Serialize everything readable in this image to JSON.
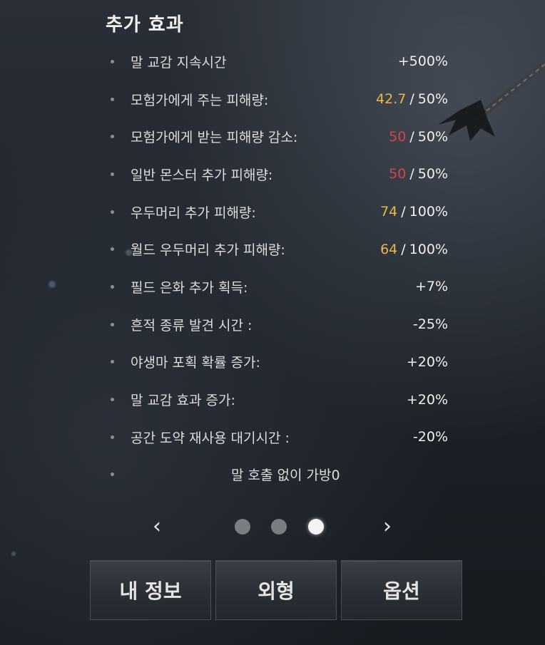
{
  "section": {
    "title": "추가 효과"
  },
  "effects": [
    {
      "label": "말 교감 지속시간",
      "value": "+500%"
    },
    {
      "label": "모험가에게 주는 피해량:",
      "current": "42.7",
      "current_color": "#e8b84a",
      "max": "50%"
    },
    {
      "label": "모험가에게 받는 피해량 감소:",
      "current": "50",
      "current_color": "#d5454a",
      "max": "50%"
    },
    {
      "label": "일반 몬스터 추가 피해량:",
      "current": "50",
      "current_color": "#d5454a",
      "max": "50%"
    },
    {
      "label": "우두머리 추가 피해량:",
      "current": "74",
      "current_color": "#e8b84a",
      "max": "100%"
    },
    {
      "label": "월드 우두머리 추가 피해량:",
      "current": "64",
      "current_color": "#e8b84a",
      "max": "100%"
    },
    {
      "label": "필드 은화 추가 획득:",
      "value": "+7%"
    },
    {
      "label": "흔적 종류 발견 시간 :",
      "value": "-25%"
    },
    {
      "label": "야생마 포획 확률 증가:",
      "value": "+20%"
    },
    {
      "label": "말 교감 효과 증가:",
      "value": "+20%"
    },
    {
      "label": "공간 도약 재사용 대기시간 :",
      "value": "-20%"
    },
    {
      "label": "말 호출 없이 가방0"
    }
  ],
  "separator": "/",
  "pager": {
    "prev_icon": "‹",
    "next_icon": "›",
    "active_page": 3,
    "total_pages": 3
  },
  "buttons": {
    "my_info": "내 정보",
    "appearance": "외형",
    "options": "옵션"
  },
  "colors": {
    "highlight_yellow": "#e8b84a",
    "highlight_red": "#d5454a"
  }
}
